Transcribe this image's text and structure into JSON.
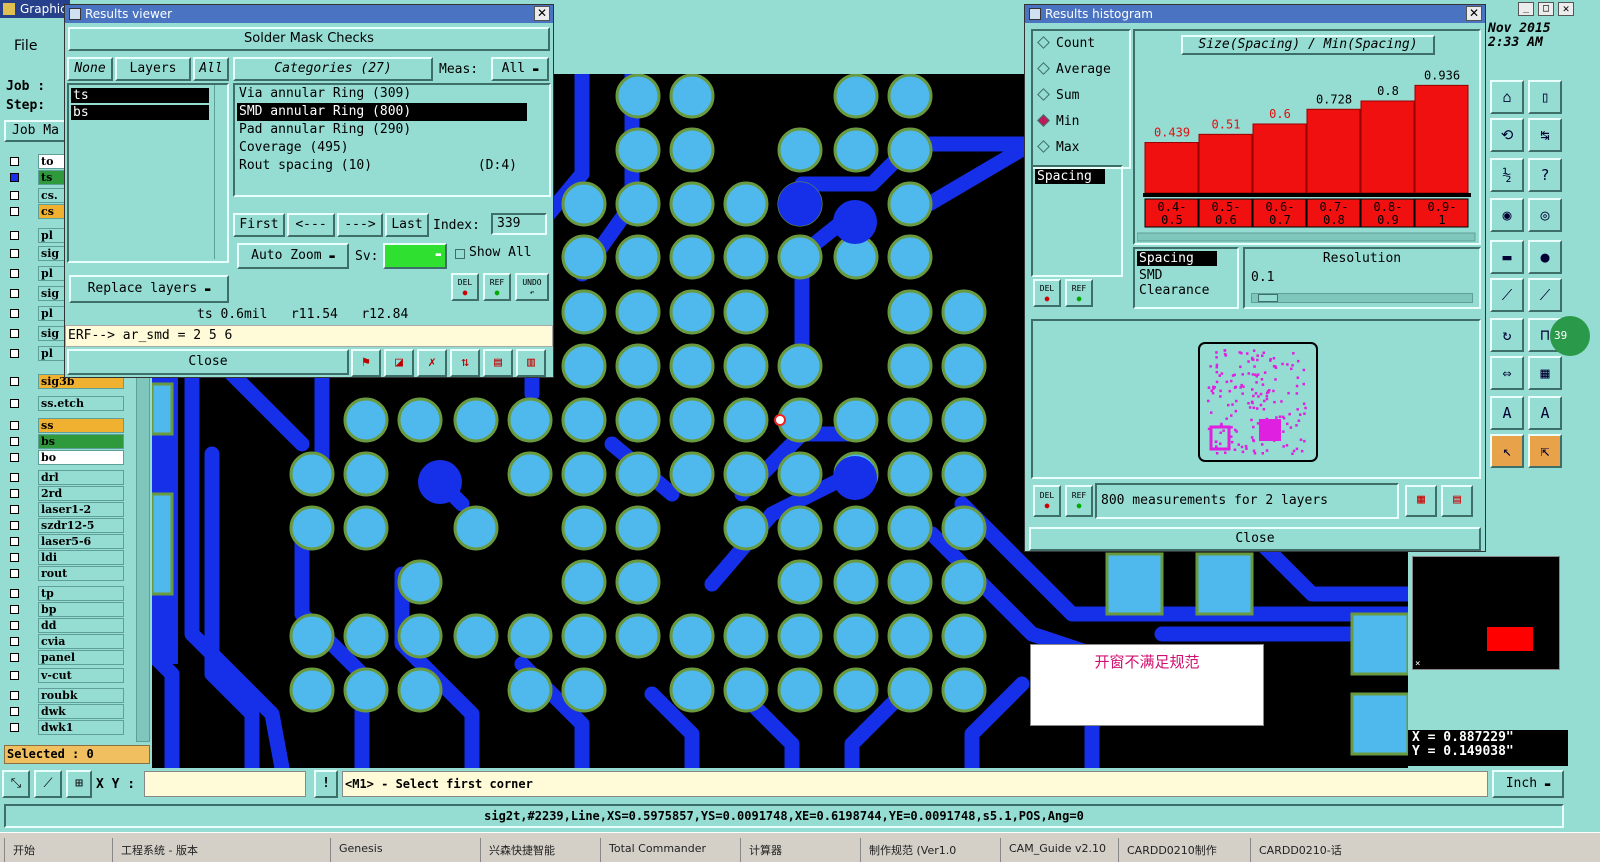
{
  "app": {
    "title_fragment": "Graphic",
    "menu": [
      "File",
      "E"
    ],
    "job_label": "Job :",
    "step_label": "Step:",
    "job_matrix_label": "Job Ma"
  },
  "layers": [
    "to",
    "ts",
    "cs.",
    "cs",
    "pl",
    "sig",
    "pl",
    "sig",
    "pl",
    "sig",
    "pl",
    "sig3b",
    "ss.etch",
    "ss",
    "bs",
    "bo",
    "drl",
    "2rd",
    "laser1-2",
    "szdr12-5",
    "laser5-6",
    "ldi",
    "rout",
    "tp",
    "bp",
    "dd",
    "cvia",
    "panel",
    "v-cut",
    "roubk",
    "dwk",
    "dwk1"
  ],
  "selected_label": "Selected : 0",
  "results_viewer": {
    "title": "Results viewer",
    "heading": "Solder Mask Checks",
    "none_btn": "None",
    "layers_btn": "Layers",
    "all_btn": "All",
    "layer_list": [
      "ts",
      "bs"
    ],
    "categories_label": "Categories (27)",
    "meas_label": "Meas:",
    "meas_value": "All",
    "categories": [
      {
        "name": "Via annular Ring (309)",
        "extra": ""
      },
      {
        "name": "SMD annular Ring (800)",
        "extra": ""
      },
      {
        "name": "Pad annular Ring (290)",
        "extra": ""
      },
      {
        "name": "Coverage (495)",
        "extra": ""
      },
      {
        "name": "Rout spacing (10)",
        "extra": "(D:4)"
      }
    ],
    "first": "First",
    "prev": "<---",
    "next": "--->",
    "last": "Last",
    "index_label": "Index:",
    "index_value": "339",
    "auto_zoom": "Auto Zoom",
    "sv_label": "Sv:",
    "show_all": "Show All",
    "replace_layers": "Replace layers",
    "del": "DEL",
    "ref": "REF",
    "undo": "UNDO",
    "info": "ts 0.6mil   r11.54   r12.84",
    "erf": "ERF--> ar_smd = 2 5 6",
    "close": "Close"
  },
  "histogram": {
    "title": "Results histogram",
    "modes": [
      "Count",
      "Average",
      "Sum",
      "Min",
      "Max"
    ],
    "active_mode": "Min",
    "list_item": "Spacing",
    "chart_title": "Size(Spacing) / Min(Spacing)",
    "resolution_label": "Resolution",
    "resolution_value": "0.1",
    "param_list": [
      "Spacing",
      "SMD",
      "Clearance"
    ],
    "del": "DEL",
    "ref": "REF",
    "summary": "800 measurements for 2 layers",
    "close": "Close"
  },
  "chart_data": {
    "type": "bar",
    "title": "Size(Spacing) / Min(Spacing)",
    "categories": [
      "0.4-0.5",
      "0.5-0.6",
      "0.6-0.7",
      "0.7-0.8",
      "0.8-0.9",
      "0.9-1"
    ],
    "cat_top": [
      "0.4-",
      "0.5-",
      "0.6-",
      "0.7-",
      "0.8-",
      "0.9-"
    ],
    "cat_bot": [
      "0.5",
      "0.6",
      "0.7",
      "0.8",
      "0.9",
      "1"
    ],
    "values": [
      0.439,
      0.51,
      0.6,
      0.728,
      0.8,
      0.936
    ],
    "value_labels": [
      "0.439",
      "0.51",
      "0.6",
      "0.728",
      "0.8",
      "0.936"
    ],
    "colors": {
      "bar": "#f01010",
      "label": "#e01010"
    }
  },
  "clock": {
    "date": "Nov 2015",
    "time": "2:33 AM"
  },
  "badge": "39",
  "note": "开窗不满足规范",
  "coords": {
    "x": "X = 0.887229\"",
    "y": "Y = 0.149038\""
  },
  "bottom": {
    "xy_label": "X Y :",
    "prompt": "<M1> - Select first corner",
    "unit": "Inch"
  },
  "status_line": "sig2t,#2239,Line,XS=0.5975857,YS=0.0091748,XE=0.6198744,YE=0.0091748,s5.1,POS,Ang=0",
  "taskbar": [
    "开始",
    "工程系统 - 版本",
    "Genesis",
    "兴森快捷智能",
    "Total Commander",
    "计算器",
    "制作规范 (Ver1.0",
    "CAM_Guide v2.10",
    "CARDD0210制作",
    "CARDD0210-话"
  ]
}
